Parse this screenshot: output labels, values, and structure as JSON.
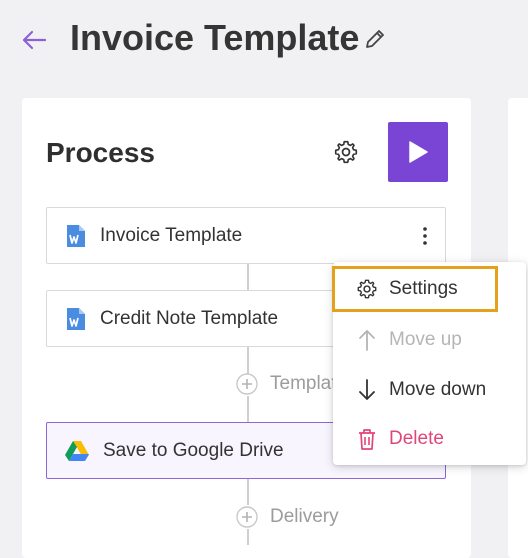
{
  "header": {
    "title": "Invoice Template"
  },
  "process": {
    "title": "Process",
    "steps": [
      {
        "label": "Invoice Template",
        "icon": "word-doc-icon"
      },
      {
        "label": "Credit Note Template",
        "icon": "word-doc-icon"
      },
      {
        "label": "Save to Google Drive",
        "icon": "google-drive-icon"
      }
    ],
    "add_template_label": "Template",
    "add_delivery_label": "Delivery"
  },
  "menu": {
    "items": [
      {
        "label": "Settings",
        "state": "enabled"
      },
      {
        "label": "Move up",
        "state": "disabled"
      },
      {
        "label": "Move down",
        "state": "enabled"
      },
      {
        "label": "Delete",
        "state": "danger"
      }
    ]
  },
  "colors": {
    "accent": "#7a45d4",
    "highlight": "#e5a11c",
    "danger": "#e0457b",
    "word_blue": "#4a8ce0"
  }
}
